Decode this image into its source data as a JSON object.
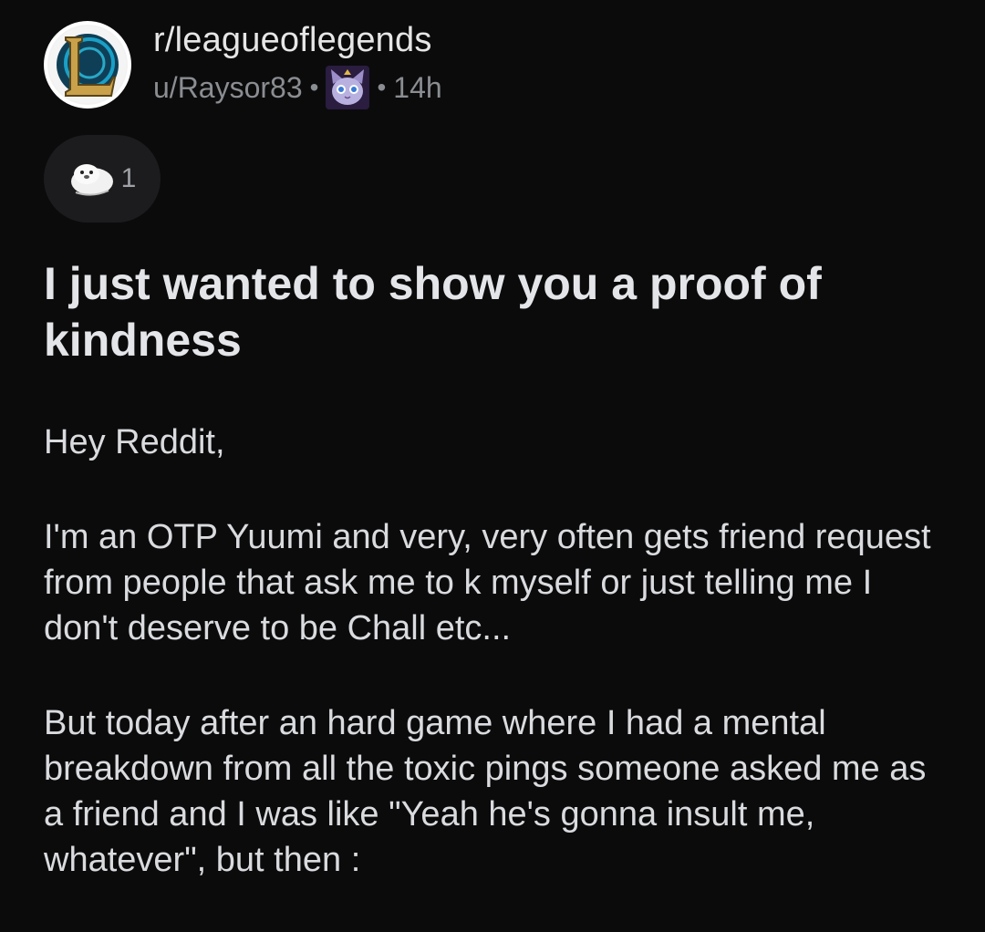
{
  "post": {
    "subreddit": "r/leagueoflegends",
    "author": "u/Raysor83",
    "separator": "•",
    "age": "14h",
    "award_count": "1",
    "title": "I just wanted to show you a proof of kindness",
    "body": [
      "Hey Reddit,",
      "I'm an OTP Yuumi and very, very often gets friend request from people that ask me to k myself or just telling me I don't deserve to be Chall etc...",
      "But today after an hard game where I had a mental breakdown from all the toxic pings someone asked me as a friend and I was like \"Yeah he's gonna insult me, whatever\", but then :"
    ]
  },
  "icons": {
    "subreddit_icon": "league-of-legends-logo",
    "author_flair": "yuumi-cat-flair",
    "award": "seal-award-icon"
  },
  "colors": {
    "background": "#0b0b0c",
    "text_primary": "#d7dadc",
    "text_muted": "#8a8d91",
    "pill_background": "#1c1c1e"
  }
}
